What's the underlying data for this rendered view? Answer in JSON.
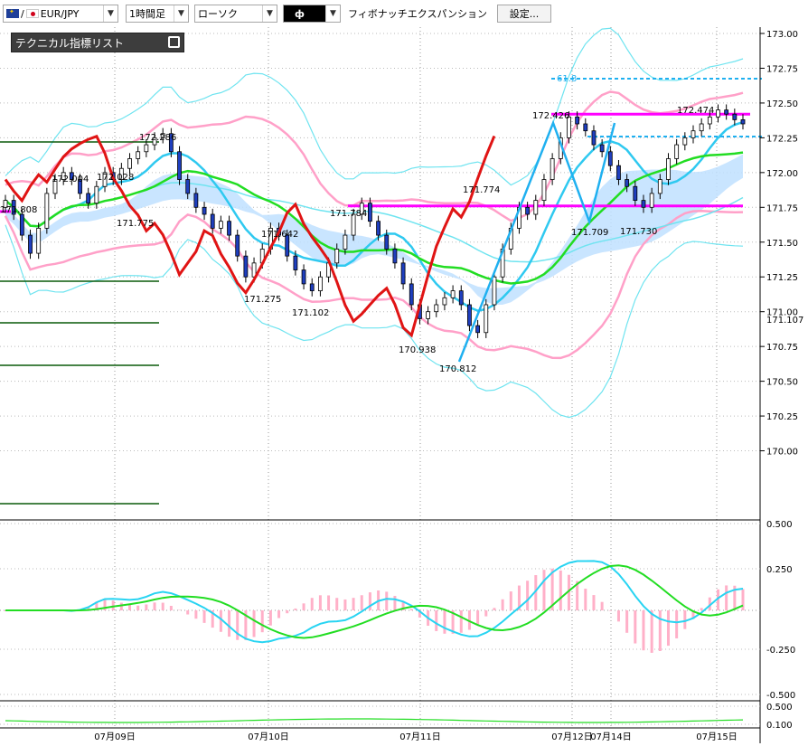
{
  "toolbar": {
    "symbol": "EUR/JPY",
    "timeframe": "1時間足",
    "chart_type": "ローソク",
    "drawing_tool": "ф",
    "tool_name": "フィボナッチエクスパンション",
    "settings_label": "設定..."
  },
  "indicator_panel": {
    "title": "テクニカル指標リスト"
  },
  "colors": {
    "up_candle": "#ffffff",
    "down_candle": "#1f3fbf",
    "bb_outer": "#6fe4f0",
    "bb_inner": "#ffa0c8",
    "ma_short": "#2fc9f0",
    "ma_mid": "#22dd22",
    "chikou": "#e01414",
    "cloud_bull": "#bfe0ff",
    "cloud_bear": "#ffc4dc",
    "hline_magenta": "#ff00ff",
    "fibo": "#1fb0f0"
  },
  "chart_data": {
    "type": "candlestick",
    "symbol": "EUR/JPY",
    "timeframe": "1時間足",
    "ylim": [
      169.75,
      173.0
    ],
    "y_ticks": [
      "173.00",
      "172.75",
      "172.50",
      "172.25",
      "172.00",
      "171.75",
      "171.50",
      "171.25",
      "171.00",
      "170.75",
      "170.50",
      "170.25",
      "170.00"
    ],
    "x_ticks": [
      "07月09日",
      "07月10日",
      "07月11日",
      "07月12日",
      "07月14日",
      "07月15日"
    ],
    "price_labels": [
      "172.286",
      "172.004",
      "172.028",
      "171.775",
      "171.642",
      "171.275",
      "171.102",
      "171.784",
      "170.938",
      "170.812",
      "171.774",
      "172.426",
      "171.709",
      "171.730",
      "172.474",
      "171.808"
    ],
    "current_price_label": "171.107",
    "fibo_label": "61.8",
    "horizontal_levels": [
      171.76,
      172.42
    ],
    "candles_count": 138,
    "close_path": [
      171.8,
      171.7,
      171.55,
      171.42,
      171.6,
      171.85,
      171.95,
      172.0,
      171.95,
      171.85,
      171.78,
      171.9,
      172.0,
      171.95,
      172.03,
      172.1,
      172.15,
      172.2,
      172.25,
      172.28,
      172.15,
      171.95,
      171.85,
      171.75,
      171.7,
      171.6,
      171.65,
      171.55,
      171.4,
      171.25,
      171.35,
      171.45,
      171.6,
      171.55,
      171.4,
      171.3,
      171.2,
      171.15,
      171.25,
      171.35,
      171.45,
      171.55,
      171.7,
      171.78,
      171.65,
      171.55,
      171.45,
      171.35,
      171.2,
      171.05,
      170.95,
      171.0,
      171.05,
      171.1,
      171.15,
      171.05,
      170.9,
      170.85,
      171.05,
      171.25,
      171.45,
      171.6,
      171.75,
      171.7,
      171.8,
      171.95,
      172.1,
      172.25,
      172.4,
      172.35,
      172.3,
      172.2,
      172.15,
      172.05,
      171.95,
      171.9,
      171.8,
      171.75,
      171.85,
      171.95,
      172.1,
      172.2,
      172.25,
      172.3,
      172.35,
      172.4,
      172.45,
      172.42,
      172.38,
      172.35
    ]
  },
  "macd_panel": {
    "y_ticks": [
      "0.500",
      "0.250",
      "-0.250",
      "-0.500"
    ]
  },
  "bottom_panel": {
    "y_ticks": [
      "0.500",
      "0.100"
    ]
  }
}
